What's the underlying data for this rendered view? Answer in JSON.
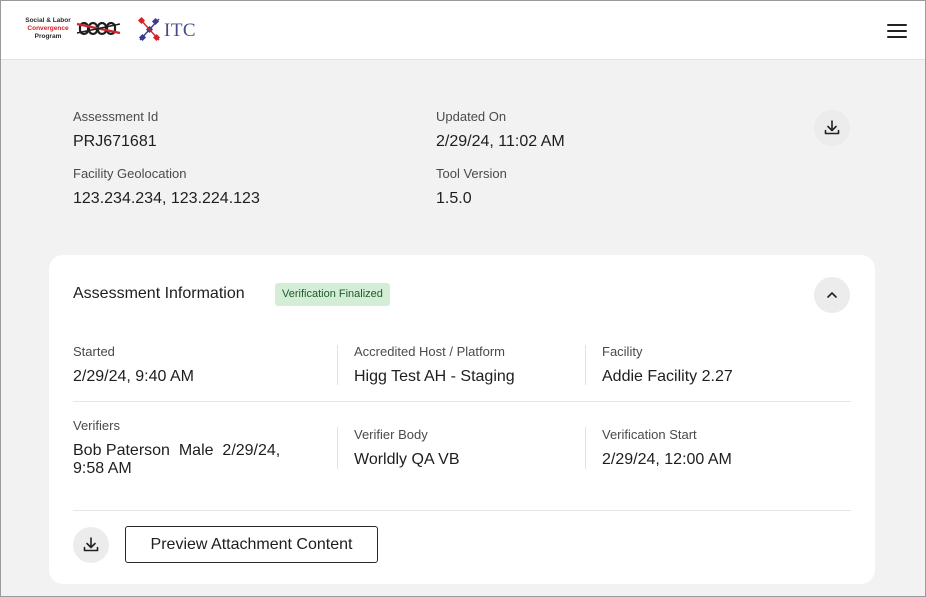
{
  "header": {
    "slcp_logo": {
      "line1": "Social & Labor",
      "line2": "Convergence",
      "line3": "Program"
    },
    "itc_logo": {
      "text": "ITC"
    },
    "menu_icon": "hamburger-menu-icon"
  },
  "summary": {
    "assessment_id_label": "Assessment Id",
    "assessment_id": "PRJ671681",
    "updated_on_label": "Updated On",
    "updated_on": "2/29/24, 11:02 AM",
    "geolocation_label": "Facility Geolocation",
    "geolocation": "123.234.234, 123.224.123",
    "tool_version_label": "Tool Version",
    "tool_version": "1.5.0",
    "download_icon": "download-icon"
  },
  "assessment_info": {
    "title": "Assessment Information",
    "status_badge": "Verification Finalized",
    "collapse_icon": "chevron-up-icon",
    "started_label": "Started",
    "started": "2/29/24, 9:40 AM",
    "host_label": "Accredited Host / Platform",
    "host": "Higg Test AH - Staging",
    "facility_label": "Facility",
    "facility": "Addie Facility 2.27",
    "verifiers_label": "Verifiers",
    "verifiers": "Bob Paterson  Male  2/29/24, 9:58 AM",
    "verifier_body_label": "Verifier Body",
    "verifier_body": "Worldly QA VB",
    "verification_start_label": "Verification Start",
    "verification_start": "2/29/24, 12:00 AM",
    "preview_button": "Preview Attachment Content",
    "download_icon": "download-icon"
  },
  "colors": {
    "page_bg": "#f2f2f2",
    "badge_bg": "#d4edd7",
    "badge_text": "#1f5c2a",
    "slcp_red": "#d2232a",
    "itc_blue": "#4a4a8a"
  }
}
